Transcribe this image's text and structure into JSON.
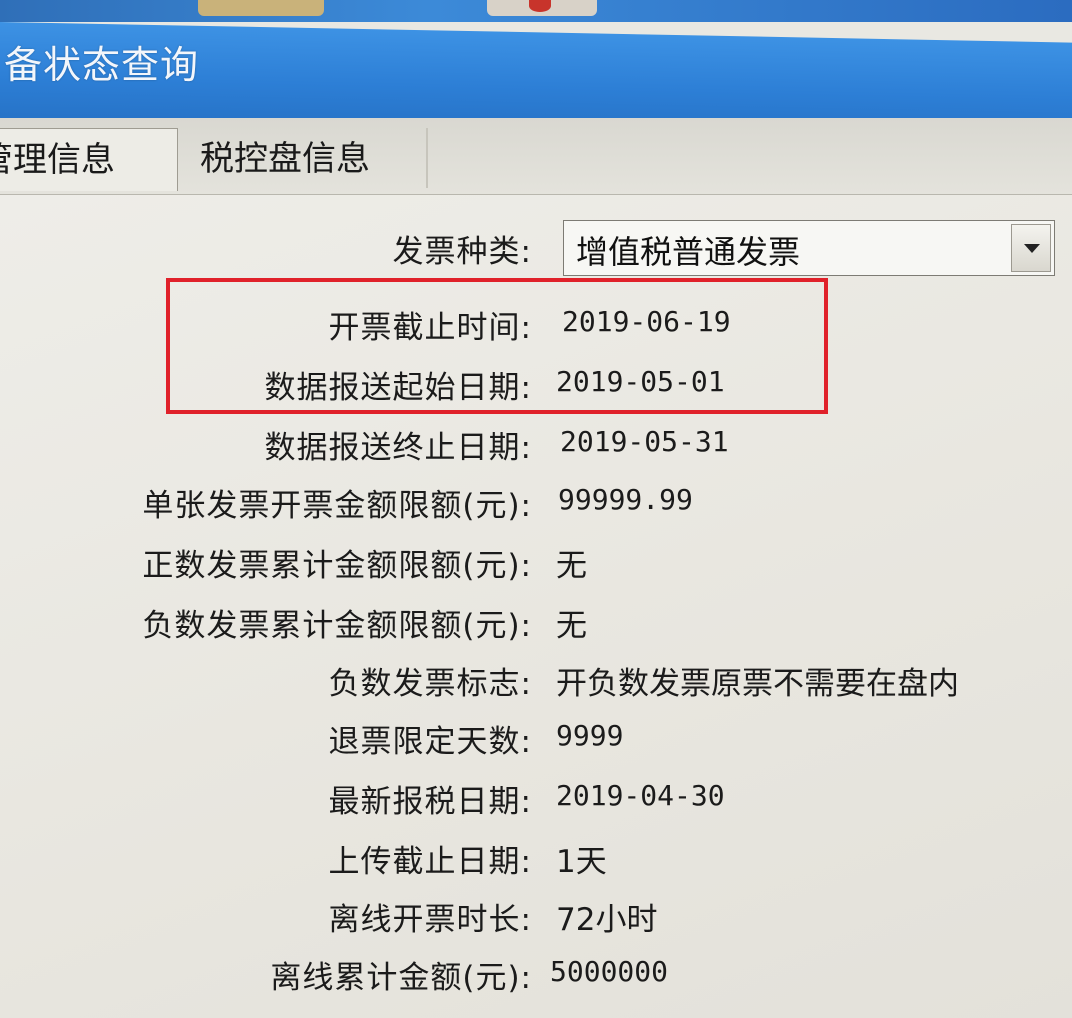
{
  "window": {
    "title": "备状态查询"
  },
  "tabs": [
    {
      "label": "管理信息",
      "active": true
    },
    {
      "label": "税控盘信息",
      "active": false
    }
  ],
  "form": {
    "invoice_type": {
      "label": "发票种类:",
      "value": "增值税普通发票"
    },
    "rows": [
      {
        "label": "开票截止时间:",
        "value": "2019-06-19"
      },
      {
        "label": "数据报送起始日期:",
        "value": "2019-05-01"
      },
      {
        "label": "数据报送终止日期:",
        "value": "2019-05-31"
      },
      {
        "label": "单张发票开票金额限额(元):",
        "value": "99999.99"
      },
      {
        "label": "正数发票累计金额限额(元):",
        "value": "无"
      },
      {
        "label": "负数发票累计金额限额(元):",
        "value": "无"
      },
      {
        "label": "负数发票标志:",
        "value": "开负数发票原票不需要在盘内"
      },
      {
        "label": "退票限定天数:",
        "value": "9999"
      },
      {
        "label": "最新报税日期:",
        "value": "2019-04-30"
      },
      {
        "label": "上传截止日期:",
        "value": "1天"
      },
      {
        "label": "离线开票时长:",
        "value": "72小时"
      },
      {
        "label": "离线累计金额(元):",
        "value": "5000000"
      }
    ]
  },
  "colors": {
    "titlebar": "#2d7fd6",
    "highlight": "#e0212a"
  }
}
